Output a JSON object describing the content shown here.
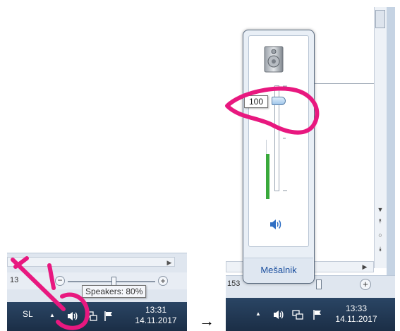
{
  "before": {
    "zoom_label": "13",
    "tooltip": "Speakers: 80%",
    "language": "SL",
    "clock_time": "13:31",
    "clock_date": "14.11.2017"
  },
  "transition_arrow": "→",
  "after": {
    "zoom_label": "153",
    "volume_value": "100",
    "volume_level": 1.0,
    "mixer_label": "Mešalnik",
    "clock_time": "13:33",
    "clock_date": "14.11.2017"
  },
  "icons": {
    "speaker": "speaker-icon",
    "network": "network-icon",
    "flag": "action-center-flag-icon",
    "device": "speaker-device-icon",
    "show_hidden": "up-arrow-icon"
  },
  "colors": {
    "taskbar": "#1f3550",
    "annotation": "#e8187f",
    "meter": "#39a93b",
    "link": "#1b4f9e"
  }
}
